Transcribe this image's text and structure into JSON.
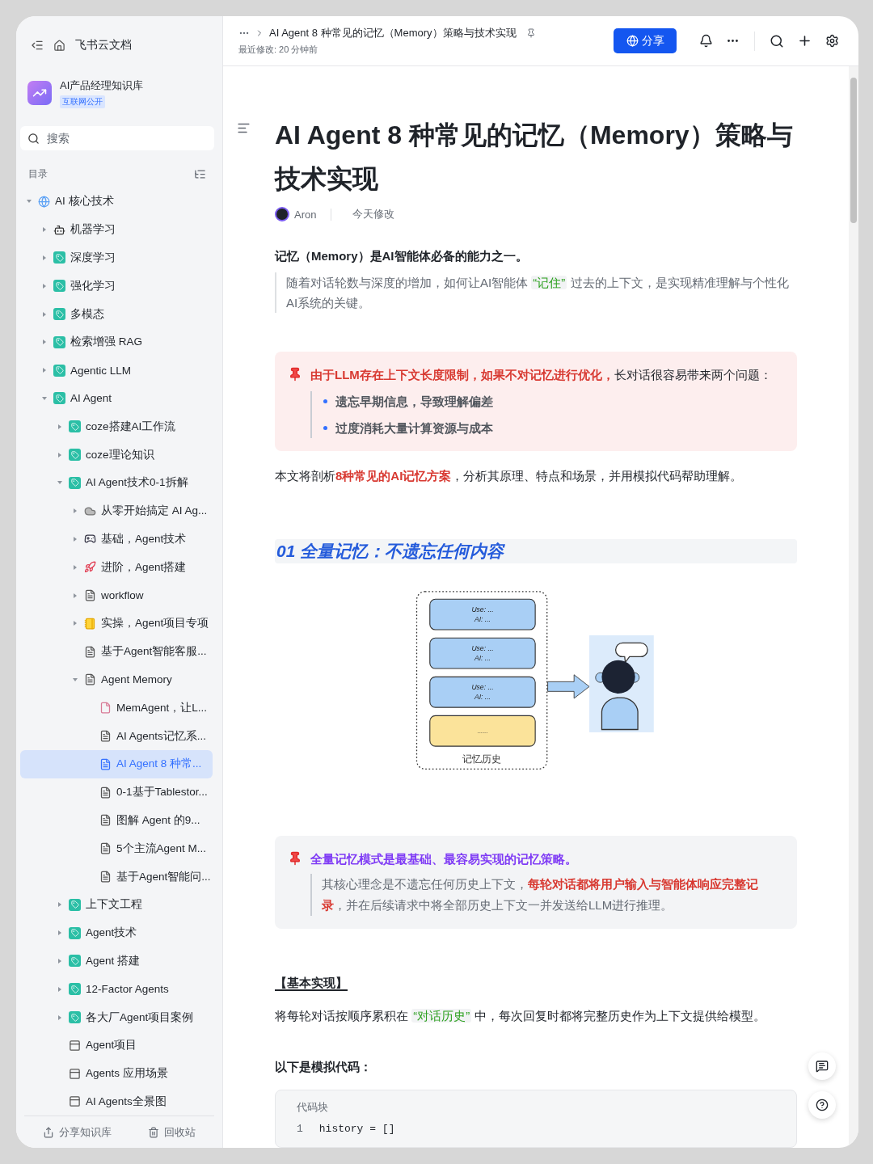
{
  "sidebar": {
    "app_title": "飞书云文档",
    "space": {
      "name": "AI产品经理知识库",
      "badge": "互联网公开"
    },
    "search": {
      "placeholder": "搜索"
    },
    "toc_label": "目录",
    "tree": [
      {
        "label": "AI 核心技术",
        "kind": "globe",
        "expanded": true,
        "selected": false,
        "children": [
          {
            "label": "机器学习",
            "kind": "robot",
            "expanded": false,
            "selected": false
          },
          {
            "label": "深度学习",
            "kind": "tag",
            "expanded": false,
            "selected": false
          },
          {
            "label": "强化学习",
            "kind": "tag",
            "expanded": false,
            "selected": false
          },
          {
            "label": "多模态",
            "kind": "tag",
            "expanded": false,
            "selected": false
          },
          {
            "label": "检索增强 RAG",
            "kind": "tag",
            "expanded": false,
            "selected": false
          },
          {
            "label": "Agentic LLM",
            "kind": "tag",
            "expanded": false,
            "selected": false
          },
          {
            "label": "AI Agent",
            "kind": "tag",
            "expanded": true,
            "selected": false,
            "children": [
              {
                "label": "coze搭建AI工作流",
                "kind": "tag",
                "expanded": false,
                "selected": false
              },
              {
                "label": "coze理论知识",
                "kind": "tag",
                "expanded": false,
                "selected": false
              },
              {
                "label": "AI Agent技术0-1拆解",
                "kind": "tag",
                "expanded": true,
                "selected": false,
                "children": [
                  {
                    "label": "从零开始搞定 AI Ag...",
                    "kind": "cloud",
                    "expanded": false,
                    "selected": false
                  },
                  {
                    "label": "基础，Agent技术",
                    "kind": "game",
                    "expanded": false,
                    "selected": false
                  },
                  {
                    "label": "进阶，Agent搭建",
                    "kind": "rocket",
                    "expanded": false,
                    "selected": false
                  },
                  {
                    "label": "workflow",
                    "kind": "doc",
                    "expanded": false,
                    "selected": false
                  },
                  {
                    "label": "实操，Agent项目专项",
                    "kind": "notebook",
                    "expanded": false,
                    "selected": false
                  },
                  {
                    "label": "基于Agent智能客服...",
                    "kind": "doc",
                    "selected": false
                  },
                  {
                    "label": "Agent Memory",
                    "kind": "doc",
                    "expanded": true,
                    "selected": false,
                    "children": [
                      {
                        "label": "MemAgent，让L...",
                        "kind": "file",
                        "selected": false
                      },
                      {
                        "label": "AI Agents记忆系...",
                        "kind": "doc",
                        "selected": false
                      },
                      {
                        "label": "AI Agent 8 种常...",
                        "kind": "doc",
                        "selected": true
                      },
                      {
                        "label": "0-1基于Tablestor...",
                        "kind": "doc",
                        "selected": false
                      },
                      {
                        "label": "图解 Agent 的9...",
                        "kind": "doc",
                        "selected": false
                      },
                      {
                        "label": "5个主流Agent M...",
                        "kind": "doc",
                        "selected": false
                      },
                      {
                        "label": "基于Agent智能问...",
                        "kind": "doc",
                        "selected": false
                      }
                    ]
                  }
                ]
              },
              {
                "label": "上下文工程",
                "kind": "tag",
                "expanded": false,
                "selected": false
              },
              {
                "label": "Agent技术",
                "kind": "tag",
                "expanded": false,
                "selected": false
              },
              {
                "label": "Agent 搭建",
                "kind": "tag",
                "expanded": false,
                "selected": false
              },
              {
                "label": "12-Factor Agents",
                "kind": "tag",
                "expanded": false,
                "selected": false
              },
              {
                "label": "各大厂Agent项目案例",
                "kind": "tag",
                "expanded": false,
                "selected": false
              },
              {
                "label": "Agent项目",
                "kind": "board",
                "selected": false
              },
              {
                "label": "Agents 应用场景",
                "kind": "board",
                "selected": false
              },
              {
                "label": "AI Agents全景图",
                "kind": "board",
                "selected": false
              }
            ]
          }
        ]
      }
    ],
    "footer": [
      {
        "label": "分享知识库",
        "kind": "share"
      },
      {
        "label": "回收站",
        "kind": "trash"
      }
    ]
  },
  "header": {
    "doc_title": "AI Agent 8 种常见的记忆（Memory）策略与技术实现",
    "modified": "最近修改: 20 分钟前",
    "share_button": "分享"
  },
  "document": {
    "title": "AI Agent 8 种常见的记忆（Memory）策略与技术实现",
    "author": "Aron",
    "edited": "今天修改",
    "blocks": [
      {
        "kind": "lead",
        "text": "记忆（Memory）是AI智能体必备的能力之一。"
      },
      {
        "kind": "quote",
        "segments": [
          {
            "kind": "plain",
            "text": "随着对话轮数与深度的增加，如何让AI智能体 "
          },
          {
            "kind": "highlight",
            "text": "“记住”"
          },
          {
            "kind": "plain",
            "text": " 过去的上下文，是实现精准理解与个性化AI系统的关键。"
          }
        ]
      },
      {
        "kind": "warning-callout",
        "segments": [
          {
            "kind": "alert",
            "text": "由于LLM存在上下文长度限制，如果不对记忆进行优化，"
          },
          {
            "kind": "plain",
            "text": "长对话很容易带来两个问题："
          }
        ],
        "bullets": [
          "遗忘早期信息，导致理解偏差",
          "过度消耗大量计算资源与成本"
        ]
      },
      {
        "kind": "para",
        "segments": [
          {
            "kind": "plain",
            "text": "本文将剖析"
          },
          {
            "kind": "alert",
            "text": "8种常见的AI记忆方案"
          },
          {
            "kind": "plain",
            "text": "，分析其原理、特点和场景，并用模拟代码帮助理解。"
          }
        ]
      },
      {
        "kind": "heading",
        "text": "01 全量记忆：不遗忘任何内容"
      },
      {
        "kind": "diagram",
        "cards": [
          {
            "user": "Use: ...",
            "ai": "AI: ..."
          },
          {
            "user": "Use: ...",
            "ai": "AI: ..."
          },
          {
            "user": "Use: ...",
            "ai": "AI: ..."
          }
        ],
        "filler": "......",
        "caption": "记忆历史"
      },
      {
        "kind": "note-callout",
        "segments": [
          {
            "kind": "accent",
            "text": "全量记忆模式是最基础、最容易实现的记忆策略。"
          }
        ],
        "quote": [
          {
            "kind": "plain",
            "text": "其核心理念是不遗忘任何历史上下文，"
          },
          {
            "kind": "alert",
            "text": "每轮对话都将用户输入与智能体响应完整记录"
          },
          {
            "kind": "plain",
            "text": "，并在后续请求中将全部历史上下文一并发送给LLM进行推理。"
          }
        ]
      },
      {
        "kind": "subheading",
        "text": "【基本实现】"
      },
      {
        "kind": "para",
        "segments": [
          {
            "kind": "plain",
            "text": "将每轮对话按顺序累积在 "
          },
          {
            "kind": "highlight",
            "text": "“对话历史”"
          },
          {
            "kind": "plain",
            "text": " 中，每次回复时都将完整历史作为上下文提供给模型。"
          }
        ]
      },
      {
        "kind": "label",
        "text": "以下是模拟代码："
      },
      {
        "kind": "code",
        "label": "代码块",
        "lines": [
          {
            "number": "1",
            "text": "history = []"
          }
        ]
      }
    ]
  }
}
